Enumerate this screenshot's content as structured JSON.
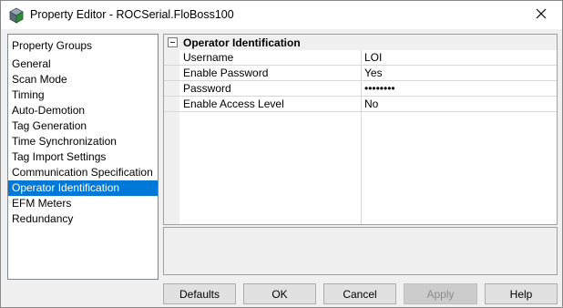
{
  "window": {
    "title": "Property Editor - ROCSerial.FloBoss100",
    "app_icon": "property-editor-icon",
    "close_icon": "close-icon"
  },
  "groups": {
    "header": "Property Groups",
    "items": [
      {
        "label": "General"
      },
      {
        "label": "Scan Mode"
      },
      {
        "label": "Timing"
      },
      {
        "label": "Auto-Demotion"
      },
      {
        "label": "Tag Generation"
      },
      {
        "label": "Time Synchronization"
      },
      {
        "label": "Tag Import Settings"
      },
      {
        "label": "Communication Specification"
      },
      {
        "label": "Operator Identification",
        "selected": true
      },
      {
        "label": "EFM Meters"
      },
      {
        "label": "Redundancy"
      }
    ]
  },
  "grid": {
    "category": "Operator Identification",
    "toggle_icon": "collapse-minus-icon",
    "rows": [
      {
        "name": "Username",
        "value": "LOI"
      },
      {
        "name": "Enable Password",
        "value": "Yes"
      },
      {
        "name": "Password",
        "value": "••••••••"
      },
      {
        "name": "Enable Access Level",
        "value": "No"
      }
    ]
  },
  "description": {
    "text": ""
  },
  "buttons": {
    "defaults": "Defaults",
    "ok": "OK",
    "cancel": "Cancel",
    "apply": "Apply",
    "help": "Help"
  },
  "colors": {
    "selection": "#0078d7",
    "button_face": "#e1e1e1",
    "window_bg": "#f0f0f0"
  }
}
